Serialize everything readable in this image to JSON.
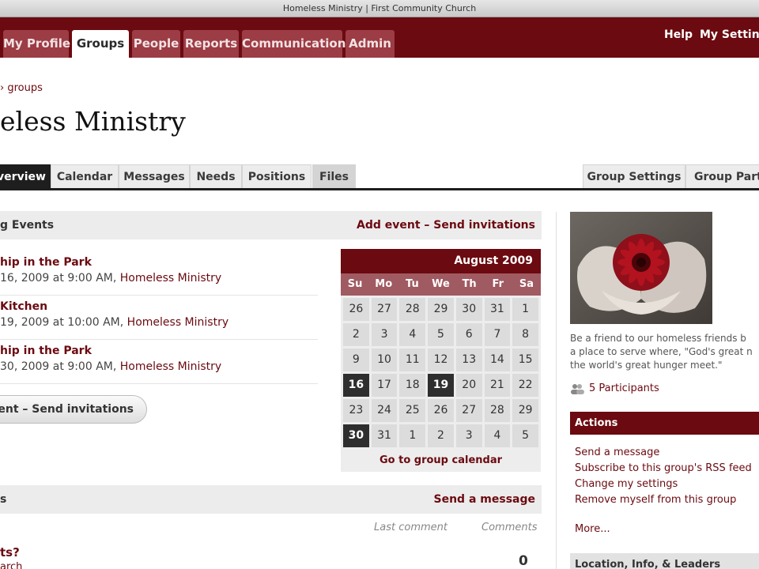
{
  "window": {
    "title": "Homeless Ministry | First Community Church"
  },
  "topnav": {
    "tabs": [
      "My Profile",
      "Groups",
      "People",
      "Reports",
      "Communication",
      "Admin"
    ],
    "active": "Groups",
    "help": "Help",
    "settings": "My Settings"
  },
  "breadcrumb": "groups",
  "page_title": "eless Ministry",
  "subtabs": {
    "left": [
      "verview",
      "Calendar",
      "Messages",
      "Needs",
      "Positions",
      "Files"
    ],
    "right": [
      "Group Settings",
      "Group Parti"
    ]
  },
  "events": {
    "header": "g Events",
    "header_link": "Add event – Send invitations",
    "items": [
      {
        "title": "hip in the Park",
        "date": "16, 2009 at 9:00 AM,",
        "group": "Homeless Ministry"
      },
      {
        "title": "Kitchen",
        "date": "19, 2009 at 10:00 AM,",
        "group": "Homeless Ministry"
      },
      {
        "title": "hip in the Park",
        "date": "30, 2009 at 9:00 AM,",
        "group": "Homeless Ministry"
      }
    ],
    "button": "vent – Send invitations"
  },
  "calendar": {
    "month": "August 2009",
    "dow": [
      "Su",
      "Mo",
      "Tu",
      "We",
      "Th",
      "Fr",
      "Sa"
    ],
    "days": [
      "26",
      "27",
      "28",
      "29",
      "30",
      "31",
      "1",
      "2",
      "3",
      "4",
      "5",
      "6",
      "7",
      "8",
      "9",
      "10",
      "11",
      "12",
      "13",
      "14",
      "15",
      "16",
      "17",
      "18",
      "19",
      "20",
      "21",
      "22",
      "23",
      "24",
      "25",
      "26",
      "27",
      "28",
      "29",
      "30",
      "31",
      "1",
      "2",
      "3",
      "4",
      "5"
    ],
    "highlighted": [
      "16",
      "19",
      "30"
    ],
    "footer": "Go to group calendar"
  },
  "messages": {
    "header": "s",
    "header_link": "Send a message",
    "col_last": "Last comment",
    "col_comments": "Comments",
    "first_title": "ts?",
    "first_sub": "arch",
    "first_count": "0"
  },
  "sidebar": {
    "blurb_lines": [
      "Be a friend to our homeless friends b",
      "a place to serve where, \"God's great n",
      "the world's great hunger meet.\""
    ],
    "participants": "5 Participants",
    "actions_header": "Actions",
    "actions": [
      "Send a message",
      "Subscribe to this group's RSS feed",
      "Change my settings",
      "Remove myself from this group"
    ],
    "more": "More...",
    "location_header": "Location, Info, & Leaders"
  },
  "colors": {
    "brand": "#6b0a10",
    "tab_inactive": "#9c3c45",
    "calendar_dow": "#a05a62"
  }
}
